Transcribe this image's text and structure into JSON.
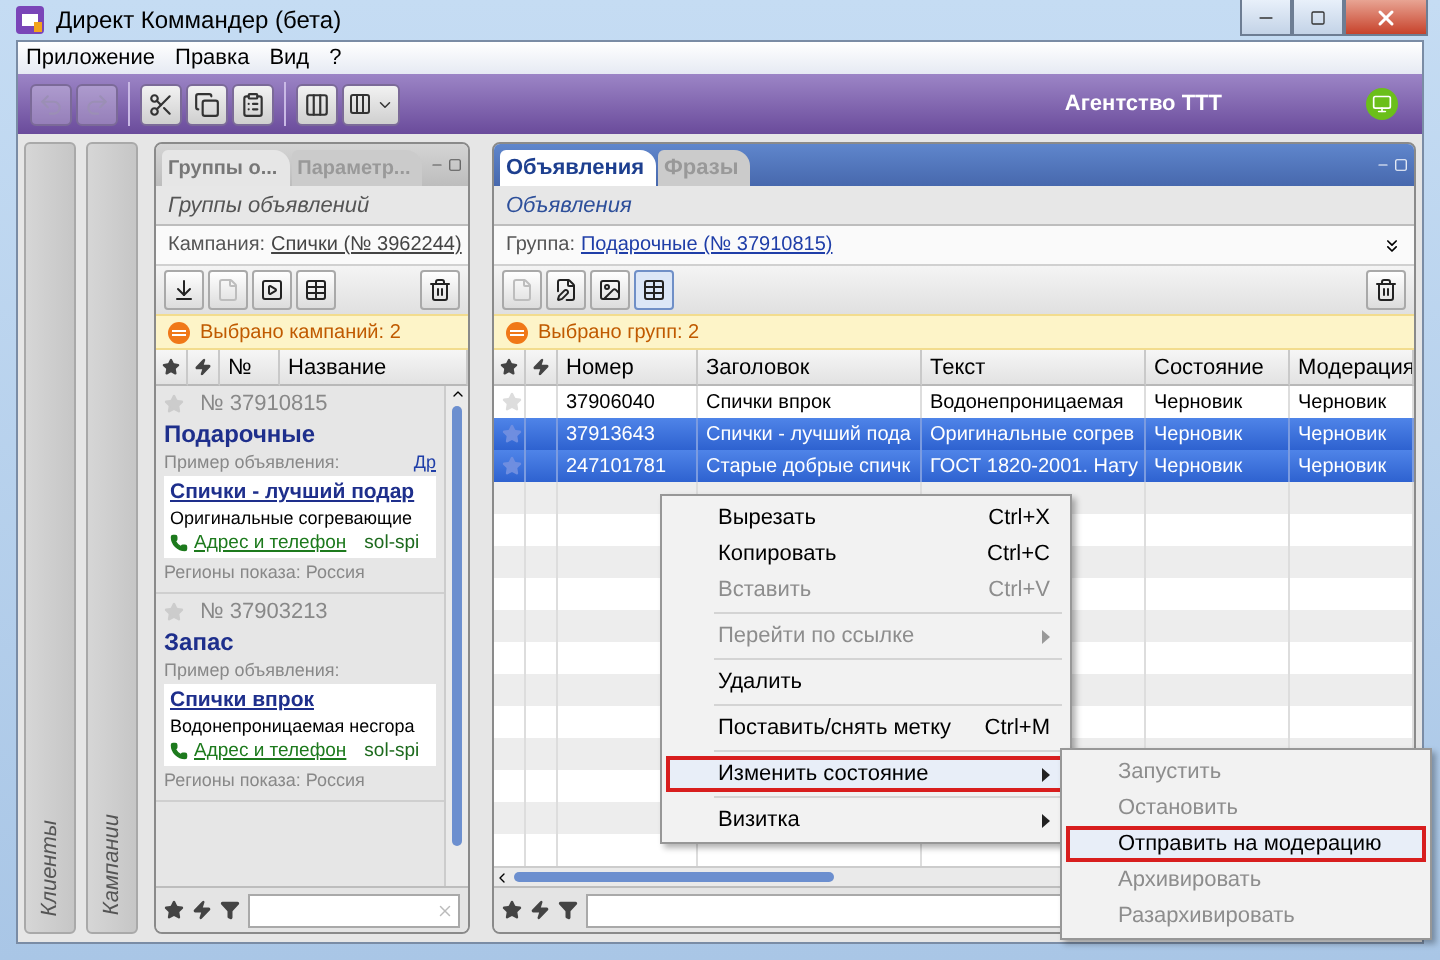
{
  "window": {
    "title": "Директ Коммандер (бета)"
  },
  "menu": [
    "Приложение",
    "Правка",
    "Вид",
    "?"
  ],
  "toolbar": {
    "account": "Агентство ТТТ"
  },
  "side_panels": [
    "Клиенты",
    "Кампании"
  ],
  "left_panel": {
    "tabs": [
      {
        "label": "Группы о...",
        "selected": true
      },
      {
        "label": "Параметр...",
        "selected": false
      }
    ],
    "subtitle": "Группы объявлений",
    "context_label": "Кампания:",
    "context_link": "Спички (№ 3962244)",
    "notice": "Выбрано кампаний: 2",
    "columns": [
      "№",
      "Название"
    ],
    "groups": [
      {
        "number": "№ 37910815",
        "name": "Подарочные",
        "example_label": "Пример объявления:",
        "example_link": "Др",
        "ad_title": "Спички - лучший подар",
        "ad_text": "Оригинальные согревающие",
        "contact": "Адрес и телефон",
        "domain": "sol-spi",
        "regions": "Регионы показа: Россия"
      },
      {
        "number": "№ 37903213",
        "name": "Запас",
        "example_label": "Пример объявления:",
        "ad_title": "Спички впрок",
        "ad_text": "Водонепроницаемая несгора",
        "contact": "Адрес и телефон",
        "domain": "sol-spi",
        "regions": "Регионы показа: Россия"
      }
    ]
  },
  "right_panel": {
    "tabs": [
      {
        "label": "Объявления",
        "selected": true
      },
      {
        "label": "Фразы",
        "selected": false
      }
    ],
    "subtitle": "Объявления",
    "context_label": "Группа:",
    "context_link": "Подарочные (№ 37910815)",
    "notice": "Выбрано групп: 2",
    "columns": [
      "Номер",
      "Заголовок",
      "Текст",
      "Состояние",
      "Модерация"
    ],
    "rows": [
      {
        "selected": false,
        "cells": [
          "37906040",
          "Спички впрок",
          "Водонепроницаемая",
          "Черновик",
          "Черновик"
        ]
      },
      {
        "selected": true,
        "cells": [
          "37913643",
          "Спички - лучший пода",
          "Оригинальные согрев",
          "Черновик",
          "Черновик"
        ]
      },
      {
        "selected": true,
        "cells": [
          "247101781",
          "Старые добрые спичк",
          "ГОСТ 1820-2001. Нату",
          "Черновик",
          "Черновик"
        ]
      }
    ]
  },
  "context_menu": {
    "items": [
      {
        "kind": "action",
        "label": "Вырезать",
        "shortcut": "Ctrl+X",
        "disabled": false,
        "submenu": false,
        "highlighted": false
      },
      {
        "kind": "action",
        "label": "Копировать",
        "shortcut": "Ctrl+C",
        "disabled": false,
        "submenu": false,
        "highlighted": false
      },
      {
        "kind": "action",
        "label": "Вставить",
        "shortcut": "Ctrl+V",
        "disabled": true,
        "submenu": false,
        "highlighted": false
      },
      {
        "kind": "separator"
      },
      {
        "kind": "action",
        "label": "Перейти по ссылке",
        "disabled": true,
        "submenu": true,
        "highlighted": false
      },
      {
        "kind": "separator"
      },
      {
        "kind": "action",
        "label": "Удалить",
        "disabled": false,
        "submenu": false,
        "highlighted": false
      },
      {
        "kind": "separator"
      },
      {
        "kind": "action",
        "label": "Поставить/снять метку",
        "shortcut": "Ctrl+M",
        "disabled": false,
        "submenu": false,
        "highlighted": false
      },
      {
        "kind": "separator"
      },
      {
        "kind": "action",
        "label": "Изменить состояние",
        "disabled": false,
        "submenu": true,
        "highlighted": true
      },
      {
        "kind": "separator"
      },
      {
        "kind": "action",
        "label": "Визитка",
        "disabled": false,
        "submenu": true,
        "highlighted": false
      }
    ]
  },
  "submenu": {
    "items": [
      {
        "label": "Запустить",
        "disabled": true,
        "highlighted": false
      },
      {
        "label": "Остановить",
        "disabled": true,
        "highlighted": false
      },
      {
        "label": "Отправить на модерацию",
        "disabled": false,
        "highlighted": true
      },
      {
        "label": "Архивировать",
        "disabled": true,
        "highlighted": false
      },
      {
        "label": "Разархивировать",
        "disabled": true,
        "highlighted": false
      }
    ]
  }
}
